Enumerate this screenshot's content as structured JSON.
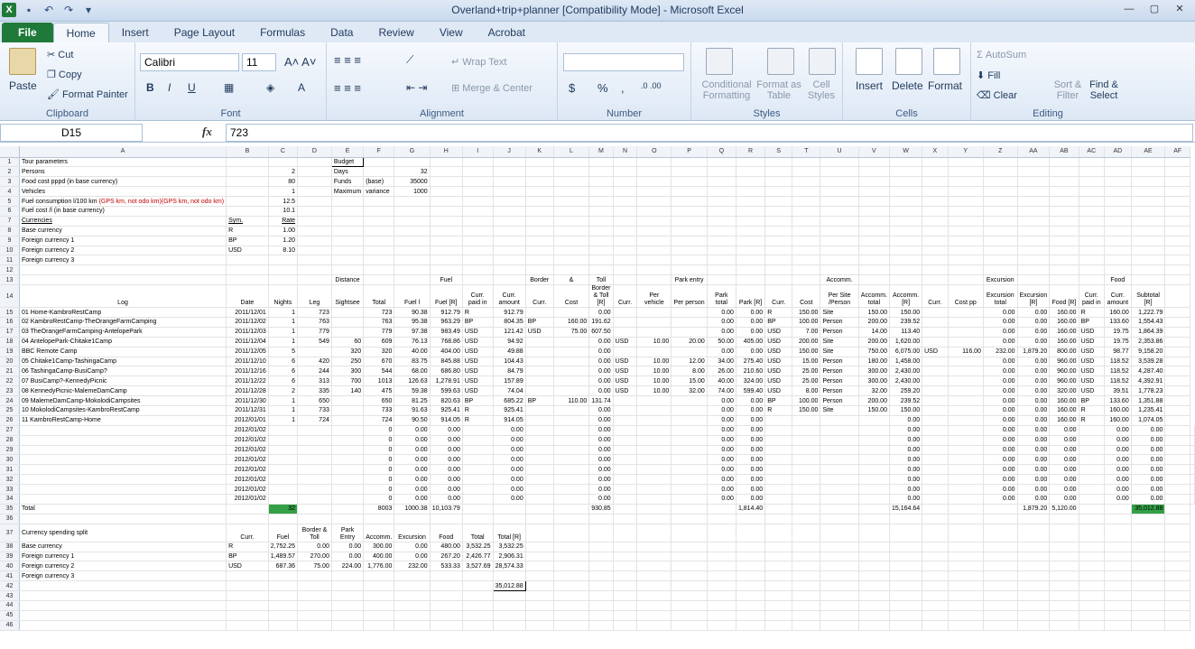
{
  "window": {
    "title": "Overland+trip+planner  [Compatibility Mode]  -  Microsoft Excel"
  },
  "tabs": [
    "File",
    "Home",
    "Insert",
    "Page Layout",
    "Formulas",
    "Data",
    "Review",
    "View",
    "Acrobat"
  ],
  "ribbon": {
    "clipboard": {
      "label": "Clipboard",
      "paste": "Paste",
      "cut": "Cut",
      "copy": "Copy",
      "format_painter": "Format Painter"
    },
    "font": {
      "label": "Font",
      "name": "Calibri",
      "size": "11"
    },
    "alignment": {
      "label": "Alignment",
      "wrap": "Wrap Text",
      "merge": "Merge & Center"
    },
    "number": {
      "label": "Number",
      "currency": "$",
      "percent": "%",
      "comma": ","
    },
    "styles": {
      "label": "Styles",
      "cond": "Conditional Formatting",
      "table": "Format as Table",
      "cell": "Cell Styles"
    },
    "cells": {
      "label": "Cells",
      "insert": "Insert",
      "delete": "Delete",
      "format": "Format"
    },
    "editing": {
      "label": "Editing",
      "autosum": "AutoSum",
      "fill": "Fill",
      "clear": "Clear",
      "sort": "Sort & Filter",
      "find": "Find & Select"
    }
  },
  "formula_bar": {
    "name_box": "D15",
    "fx": "fx",
    "value": "723"
  },
  "columns": [
    "A",
    "B",
    "C",
    "D",
    "E",
    "F",
    "G",
    "H",
    "I",
    "J",
    "K",
    "L",
    "M",
    "N",
    "O",
    "P",
    "Q",
    "R",
    "S",
    "T",
    "U",
    "V",
    "W",
    "X",
    "Y",
    "Z",
    "AA",
    "AB",
    "AC",
    "AD",
    "AE",
    "AF"
  ],
  "params": {
    "title": "Tour parameters",
    "rows": [
      [
        "Persons",
        "",
        "2"
      ],
      [
        "Food cost pppd (in base currency)",
        "",
        "80"
      ],
      [
        "Vehicles",
        "",
        "1"
      ],
      [
        "Fuel consumption l/100 km",
        "(GPS km, not odo km)",
        "12.5"
      ],
      [
        "Fuel cost /l (in base currency)",
        "",
        "10.1"
      ],
      [
        "Currencies",
        "Sym.",
        "Rate"
      ],
      [
        "Base currency",
        "R",
        "1.00"
      ],
      [
        "Foreign currency 1",
        "BP",
        "1.20"
      ],
      [
        "Foreign currency 2",
        "USD",
        "8.10"
      ],
      [
        "Foreign currency 3",
        "",
        ""
      ]
    ]
  },
  "budget": {
    "title": "Budget",
    "rows": [
      [
        "Days",
        "",
        "32"
      ],
      [
        "Funds",
        "(base)",
        "35000"
      ],
      [
        "Maximum",
        "variance",
        "1000"
      ]
    ]
  },
  "groups": {
    "distance": "Distance",
    "fuel": "Fuel",
    "border": "Border",
    "amp": "&",
    "toll": "Toll",
    "park": "Park entry",
    "accom": "Accomm.",
    "excursion": "Excursion",
    "food": "Food"
  },
  "headers": [
    "Log",
    "Date",
    "Nights",
    "Leg",
    "Sightsee",
    "Total",
    "Fuel l",
    "Fuel [R]",
    "Curr. paid in",
    "Curr. amount",
    "Curr.",
    "Cost",
    "Border & Toll [R]",
    "Curr.",
    "Per vehicle",
    "Per person",
    "Park total",
    "Park [R]",
    "Curr.",
    "Cost",
    "Per Site /Person",
    "Accomm. total",
    "Accomm. [R]",
    "Curr.",
    "Cost pp",
    "Excursion total",
    "Excursion [R]",
    "Food [R]",
    "Curr. paid in",
    "Curr. amount",
    "Subtotal [R]"
  ],
  "log": [
    [
      "01 Home-KambroRestCamp",
      "2011/12/01",
      "1",
      "723",
      "",
      "723",
      "90.38",
      "912.79",
      "R",
      "912.79",
      "",
      "",
      "0.00",
      "",
      "",
      "",
      "0.00",
      "0.00",
      "R",
      "150.00",
      "Site",
      "150.00",
      "150.00",
      "",
      "",
      "0.00",
      "0.00",
      "160.00",
      "R",
      "160.00",
      "1,222.79"
    ],
    [
      "02 KambroRestCamp-TheOrangeFarmCamping",
      "2011/12/02",
      "1",
      "763",
      "",
      "763",
      "95.38",
      "963.29",
      "BP",
      "804.35",
      "BP",
      "160.00",
      "191.62",
      "",
      "",
      "",
      "0.00",
      "0.00",
      "BP",
      "100.00",
      "Person",
      "200.00",
      "239.52",
      "",
      "",
      "0.00",
      "0.00",
      "160.00",
      "BP",
      "133.60",
      "1,554.43"
    ],
    [
      "03 TheOrangeFarmCamping-AntelopePark",
      "2011/12/03",
      "1",
      "779",
      "",
      "779",
      "97.38",
      "983.49",
      "USD",
      "121.42",
      "USD",
      "75.00",
      "607.50",
      "",
      "",
      "",
      "0.00",
      "0.00",
      "USD",
      "7.00",
      "Person",
      "14.00",
      "113.40",
      "",
      "",
      "0.00",
      "0.00",
      "160.00",
      "USD",
      "19.75",
      "1,864.39"
    ],
    [
      "04 AntelopePark-Chitake1Camp",
      "2011/12/04",
      "1",
      "549",
      "60",
      "609",
      "76.13",
      "768.86",
      "USD",
      "94.92",
      "",
      "",
      "0.00",
      "USD",
      "10.00",
      "20.00",
      "50.00",
      "405.00",
      "USD",
      "200.00",
      "Site",
      "200.00",
      "1,620.00",
      "",
      "",
      "0.00",
      "0.00",
      "160.00",
      "USD",
      "19.75",
      "2,353.86"
    ],
    [
      "BBC Remote Camp",
      "2011/12/05",
      "5",
      "",
      "320",
      "320",
      "40.00",
      "404.00",
      "USD",
      "49.88",
      "",
      "",
      "0.00",
      "",
      "",
      "",
      "0.00",
      "0.00",
      "USD",
      "150.00",
      "Site",
      "750.00",
      "6,075.00",
      "USD",
      "116.00",
      "232.00",
      "1,879.20",
      "800.00",
      "USD",
      "98.77",
      "9,158.20"
    ],
    [
      "05 Chitake1Camp-TashingaCamp",
      "2011/12/10",
      "6",
      "420",
      "250",
      "670",
      "83.75",
      "845.88",
      "USD",
      "104.43",
      "",
      "",
      "0.00",
      "USD",
      "10.00",
      "12.00",
      "34.00",
      "275.40",
      "USD",
      "15.00",
      "Person",
      "180.00",
      "1,458.00",
      "",
      "",
      "0.00",
      "0.00",
      "960.00",
      "USD",
      "118.52",
      "3,539.28"
    ],
    [
      "06 TashingaCamp-BusiCamp?",
      "2011/12/16",
      "6",
      "244",
      "300",
      "544",
      "68.00",
      "686.80",
      "USD",
      "84.79",
      "",
      "",
      "0.00",
      "USD",
      "10.00",
      "8.00",
      "26.00",
      "210.60",
      "USD",
      "25.00",
      "Person",
      "300.00",
      "2,430.00",
      "",
      "",
      "0.00",
      "0.00",
      "960.00",
      "USD",
      "118.52",
      "4,287.40"
    ],
    [
      "07 BusiCamp?-KennedyPicnic",
      "2011/12/22",
      "6",
      "313",
      "700",
      "1013",
      "126.63",
      "1,278.91",
      "USD",
      "157.89",
      "",
      "",
      "0.00",
      "USD",
      "10.00",
      "15.00",
      "40.00",
      "324.00",
      "USD",
      "25.00",
      "Person",
      "300.00",
      "2,430.00",
      "",
      "",
      "0.00",
      "0.00",
      "960.00",
      "USD",
      "118.52",
      "4,392.91"
    ],
    [
      "08 KennedyPicnic-MalemeDamCamp",
      "2011/12/28",
      "2",
      "335",
      "140",
      "475",
      "59.38",
      "599.63",
      "USD",
      "74.04",
      "",
      "",
      "0.00",
      "USD",
      "10.00",
      "32.00",
      "74.00",
      "599.40",
      "USD",
      "8.00",
      "Person",
      "32.00",
      "259.20",
      "",
      "",
      "0.00",
      "0.00",
      "320.00",
      "USD",
      "39.51",
      "1,778.23"
    ],
    [
      "09 MalemeDamCamp-MokolodiCampsites",
      "2011/12/30",
      "1",
      "650",
      "",
      "650",
      "81.25",
      "820.63",
      "BP",
      "685.22",
      "BP",
      "110.00",
      "131.74",
      "",
      "",
      "",
      "0.00",
      "0.00",
      "BP",
      "100.00",
      "Person",
      "200.00",
      "239.52",
      "",
      "",
      "0.00",
      "0.00",
      "160.00",
      "BP",
      "133.60",
      "1,351.88"
    ],
    [
      "10 MokolodiCampsites-KambroRestCamp",
      "2011/12/31",
      "1",
      "733",
      "",
      "733",
      "91.63",
      "925.41",
      "R",
      "925.41",
      "",
      "",
      "0.00",
      "",
      "",
      "",
      "0.00",
      "0.00",
      "R",
      "150.00",
      "Site",
      "150.00",
      "150.00",
      "",
      "",
      "0.00",
      "0.00",
      "160.00",
      "R",
      "160.00",
      "1,235.41"
    ],
    [
      "11 KambroRestCamp-Home",
      "2012/01/01",
      "1",
      "724",
      "",
      "724",
      "90.50",
      "914.05",
      "R",
      "914.05",
      "",
      "",
      "0.00",
      "",
      "",
      "",
      "0.00",
      "0.00",
      "",
      "",
      "",
      "",
      "0.00",
      "",
      "",
      "0.00",
      "0.00",
      "160.00",
      "R",
      "160.00",
      "1,074.05"
    ]
  ],
  "empty_date": "2012/01/02",
  "totals": {
    "label": "Total",
    "nights": "32",
    "distance": "8003",
    "fuel_l": "1000.38",
    "fuel_r": "10,103.79",
    "border": "930.85",
    "park": "1,814.40",
    "accom": "15,164.64",
    "excursion": "1,879.20",
    "food": "5,120.00",
    "subtotal": "35,012.88"
  },
  "split": {
    "title": "Currency spending split",
    "headers": [
      "Curr.",
      "Fuel",
      "Border & Toll",
      "Park Entry",
      "Accomm.",
      "Excursion",
      "Food",
      "Total",
      "Total [R]"
    ],
    "rows": [
      [
        "Base currency",
        "R",
        "2,752.25",
        "0.00",
        "0.00",
        "300.00",
        "0.00",
        "480.00",
        "3,532.25",
        "3,532.25"
      ],
      [
        "Foreign currency 1",
        "BP",
        "1,489.57",
        "270.00",
        "0.00",
        "400.00",
        "0.00",
        "267.20",
        "2,426.77",
        "2,906.31"
      ],
      [
        "Foreign currency 2",
        "USD",
        "687.36",
        "75.00",
        "224.00",
        "1,776.00",
        "232.00",
        "533.33",
        "3,527.69",
        "28,574.33"
      ],
      [
        "Foreign currency 3",
        "",
        "",
        "",
        "",
        "",
        "",
        "",
        "",
        ""
      ]
    ],
    "grand_total": "35,012.88"
  }
}
